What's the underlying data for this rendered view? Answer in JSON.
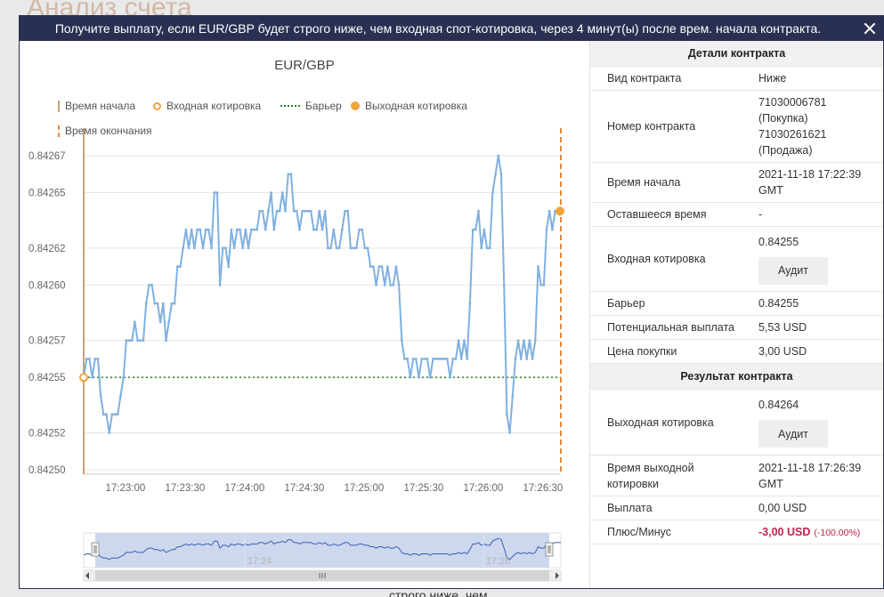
{
  "background": {
    "title": "Анализ счета",
    "footer_text": "строго ниже, чем"
  },
  "header": {
    "title": "Получите выплату, если EUR/GBP будет строго ниже, чем входная спот-котировка, через 4 минут(ы) после врем. начала контракта."
  },
  "chart": {
    "title": "EUR/GBP",
    "legend": {
      "start_time": "Время начала",
      "entry_spot": "Входная котировка",
      "barrier": "Барьер",
      "exit_spot": "Выходная котировка",
      "end_time": "Время окончания"
    },
    "navigator_labels": [
      "17:24",
      "17:26"
    ],
    "colors": {
      "line": "#7fb0e0",
      "barrier": "#2e7d32",
      "marker": "#f0a43a",
      "start": "#c9a27a",
      "end": "#e08a3a"
    }
  },
  "chart_data": {
    "type": "line",
    "title": "EUR/GBP",
    "x_unit": "time",
    "x_start": "17:22:39",
    "x_end": "17:26:39",
    "xticks": [
      "17:23:00",
      "17:23:30",
      "17:24:00",
      "17:24:30",
      "17:25:00",
      "17:25:30",
      "17:26:00",
      "17:26:30"
    ],
    "yticks": [
      "0.84250",
      "0.84252",
      "0.84255",
      "0.84257",
      "0.84260",
      "0.84262",
      "0.84265",
      "0.84267"
    ],
    "ylim": [
      0.8425,
      0.84267
    ],
    "barrier": 0.84255,
    "entry_spot": 0.84255,
    "exit_spot": 0.84264,
    "series": [
      {
        "values": [
          0.84255,
          0.84256,
          0.84256,
          0.84255,
          0.84256,
          0.84256,
          0.84254,
          0.84253,
          0.84253,
          0.84252,
          0.84253,
          0.84253,
          0.84253,
          0.84254,
          0.84255,
          0.84257,
          0.84257,
          0.84257,
          0.84258,
          0.84257,
          0.84257,
          0.84257,
          0.84259,
          0.8426,
          0.8426,
          0.84259,
          0.84259,
          0.84258,
          0.84259,
          0.84257,
          0.84258,
          0.84259,
          0.84259,
          0.84261,
          0.84261,
          0.84262,
          0.84263,
          0.84262,
          0.84263,
          0.84262,
          0.84263,
          0.84263,
          0.84262,
          0.84263,
          0.84263,
          0.84262,
          0.84265,
          0.84265,
          0.8426,
          0.84262,
          0.84262,
          0.84261,
          0.84263,
          0.84262,
          0.84263,
          0.84263,
          0.84262,
          0.84263,
          0.84262,
          0.84263,
          0.84263,
          0.84263,
          0.84264,
          0.84264,
          0.84263,
          0.84264,
          0.84265,
          0.84263,
          0.84264,
          0.84264,
          0.84265,
          0.84264,
          0.84266,
          0.84266,
          0.84264,
          0.84264,
          0.84263,
          0.84264,
          0.84264,
          0.84264,
          0.84264,
          0.84263,
          0.84263,
          0.84264,
          0.84263,
          0.84264,
          0.84262,
          0.84262,
          0.84263,
          0.84262,
          0.84262,
          0.84263,
          0.84264,
          0.84264,
          0.84262,
          0.84262,
          0.84262,
          0.84263,
          0.84263,
          0.84262,
          0.84262,
          0.84261,
          0.84261,
          0.8426,
          0.84261,
          0.84261,
          0.8426,
          0.84261,
          0.8426,
          0.8426,
          0.84261,
          0.8426,
          0.84257,
          0.84256,
          0.84256,
          0.84255,
          0.84256,
          0.84256,
          0.84255,
          0.84256,
          0.84256,
          0.84256,
          0.84255,
          0.84256,
          0.84256,
          0.84256,
          0.84256,
          0.84256,
          0.84256,
          0.84255,
          0.84256,
          0.84256,
          0.84257,
          0.84256,
          0.84257,
          0.84256,
          0.84259,
          0.84263,
          0.84263,
          0.84264,
          0.84262,
          0.84263,
          0.84262,
          0.84262,
          0.84265,
          0.84266,
          0.84267,
          0.84266,
          0.8426,
          0.84253,
          0.84252,
          0.84254,
          0.84256,
          0.84257,
          0.84256,
          0.84257,
          0.84256,
          0.84257,
          0.84256,
          0.84257,
          0.84261,
          0.8426,
          0.8426,
          0.84263,
          0.84264,
          0.84263,
          0.84264,
          0.84264,
          0.84264
        ]
      }
    ]
  },
  "details": {
    "title": "Детали контракта",
    "rows": [
      {
        "label": "Вид контракта",
        "value": "Ниже"
      },
      {
        "label": "Номер контракта",
        "value_lines": [
          "71030006781",
          "(Покупка)",
          "71030261621",
          "(Продажа)"
        ]
      },
      {
        "label": "Время начала",
        "value_lines": [
          "2021-11-18 17:22:39",
          "GMT"
        ]
      },
      {
        "label": "Оставшееся время",
        "value": "-"
      },
      {
        "label": "Входная котировка",
        "value": "0.84255",
        "button": "Аудит"
      },
      {
        "label": "Барьер",
        "value": "0.84255"
      },
      {
        "label": "Потенциальная выплата",
        "value": "5,53 USD"
      },
      {
        "label": "Цена покупки",
        "value": "3,00 USD"
      }
    ]
  },
  "result": {
    "title": "Результат контракта",
    "rows": [
      {
        "label": "Выходная котировка",
        "value": "0.84264",
        "button": "Аудит"
      },
      {
        "label_lines": [
          "Время выходной",
          "котировки"
        ],
        "value_lines": [
          "2021-11-18 17:26:39",
          "GMT"
        ]
      },
      {
        "label": "Выплата",
        "value": "0,00 USD"
      },
      {
        "label": "Плюс/Минус",
        "value": "-3,00 USD",
        "extra": "(-100.00%)"
      }
    ]
  }
}
